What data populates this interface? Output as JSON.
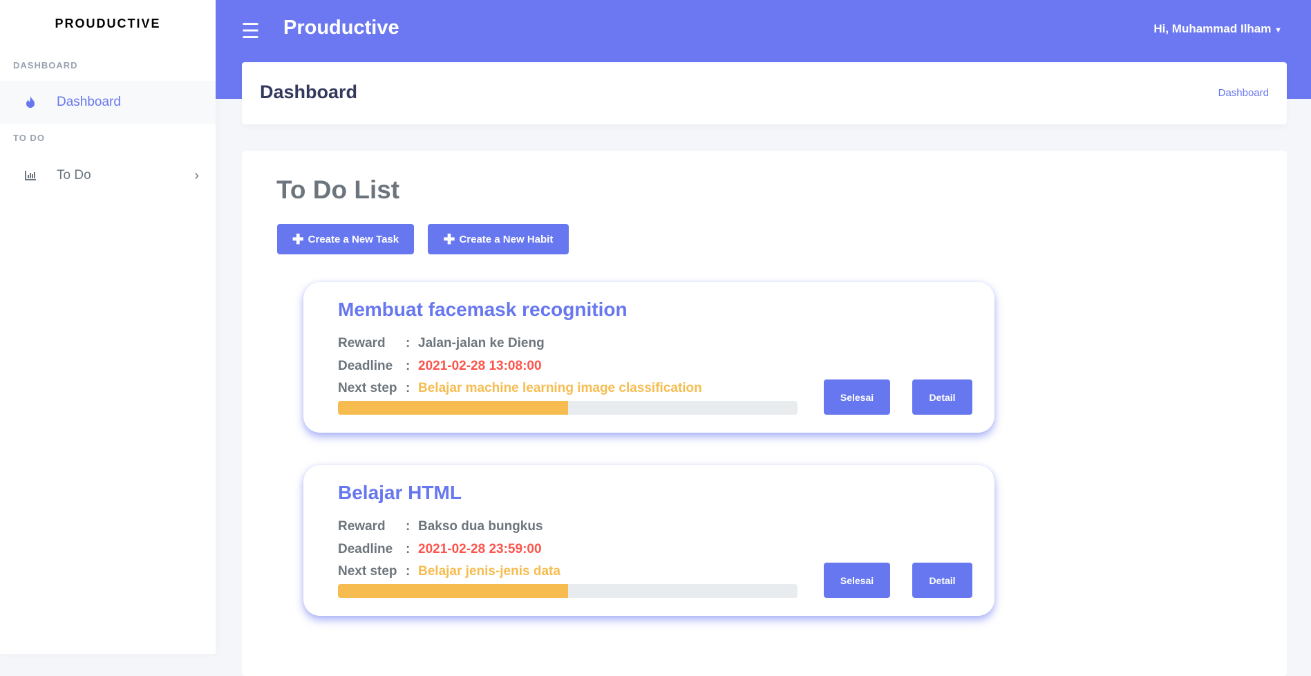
{
  "sidebar": {
    "brand": "PROUDUCTIVE",
    "sections": [
      {
        "header": "DASHBOARD",
        "item": "Dashboard"
      },
      {
        "header": "TO DO",
        "item": "To Do"
      }
    ]
  },
  "navbar": {
    "title": "Prouductive",
    "user": "Hi, Muhammad Ilham"
  },
  "section_header": {
    "title": "Dashboard",
    "breadcrumb": "Dashboard"
  },
  "main": {
    "title": "To Do List",
    "create_task": "Create a New Task",
    "create_habit": "Create a New Habit"
  },
  "labels": {
    "reward": "Reward",
    "deadline": "Deadline",
    "next_step": "Next step",
    "colon": ":",
    "done": "Selesai",
    "detail": "Detail"
  },
  "tasks": [
    {
      "title": "Membuat facemask recognition",
      "reward": "Jalan-jalan ke Dieng",
      "deadline": "2021-02-28 13:08:00",
      "next_step": "Belajar machine learning image classification",
      "progress": 50
    },
    {
      "title": "Belajar HTML",
      "reward": "Bakso dua bungkus",
      "deadline": "2021-02-28 23:59:00",
      "next_step": "Belajar jenis-jenis data",
      "progress": 50
    }
  ],
  "colors": {
    "primary": "#6777ef",
    "deadline": "#fc544b",
    "next_step": "#f6bc4f"
  }
}
